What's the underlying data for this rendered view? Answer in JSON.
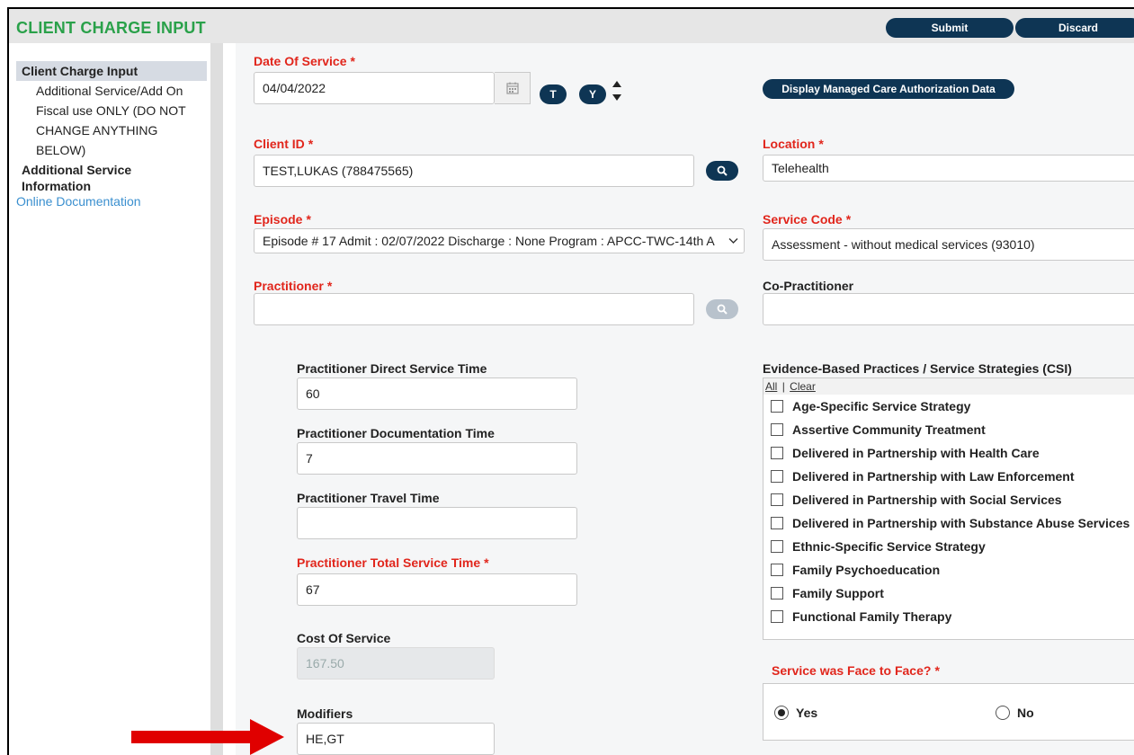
{
  "header": {
    "title": "CLIENT CHARGE INPUT",
    "submit_label": "Submit",
    "discard_label": "Discard"
  },
  "sidebar": {
    "head": "Client Charge Input",
    "items": [
      "Additional Service/Add On",
      "Fiscal use ONLY (DO NOT",
      "CHANGE ANYTHING",
      "BELOW)"
    ],
    "bold_item": "Additional Service Information",
    "online_doc": "Online Documentation"
  },
  "form": {
    "date_of_service": {
      "label": "Date Of Service",
      "value": "04/04/2022"
    },
    "today_btn": "T",
    "yesterday_btn": "Y",
    "mca_button": "Display Managed Care Authorization Data",
    "client_id": {
      "label": "Client ID",
      "value": "TEST,LUKAS (788475565)"
    },
    "location": {
      "label": "Location",
      "value": "Telehealth"
    },
    "episode": {
      "label": "Episode",
      "value": "Episode # 17 Admit : 02/07/2022 Discharge : None Program : APCC-TWC-14th A"
    },
    "service_code": {
      "label": "Service Code",
      "value": "Assessment - without medical services (93010)"
    },
    "practitioner": {
      "label": "Practitioner",
      "value": ""
    },
    "co_practitioner": {
      "label": "Co-Practitioner",
      "value": ""
    },
    "direct_time": {
      "label": "Practitioner Direct Service Time",
      "value": "60"
    },
    "doc_time": {
      "label": "Practitioner Documentation Time",
      "value": "7"
    },
    "travel_time": {
      "label": "Practitioner Travel Time",
      "value": ""
    },
    "total_time": {
      "label": "Practitioner Total Service Time",
      "value": "67"
    },
    "cost": {
      "label": "Cost Of Service",
      "value": "167.50"
    },
    "modifiers": {
      "label": "Modifiers",
      "value": "HE,GT"
    },
    "required_mark": "*"
  },
  "csi": {
    "label": "Evidence-Based Practices / Service Strategies (CSI)",
    "all_link": "All",
    "separator": "|",
    "clear_link": "Clear",
    "items": [
      "Age-Specific Service Strategy",
      "Assertive Community Treatment",
      "Delivered in Partnership with Health Care",
      "Delivered in Partnership with Law Enforcement",
      "Delivered in Partnership with Social Services",
      "Delivered in Partnership with Substance Abuse Services",
      "Ethnic-Specific Service Strategy",
      "Family Psychoeducation",
      "Family Support",
      "Functional Family Therapy"
    ]
  },
  "face_to_face": {
    "label": "Service was Face to Face?",
    "yes": "Yes",
    "no": "No",
    "selected": "Yes"
  },
  "colors": {
    "title_green": "#2aa14a",
    "button_navy": "#0e3554",
    "required_red": "#e1261c",
    "link_blue": "#3a8fcf",
    "arrow_red": "#e00000"
  }
}
